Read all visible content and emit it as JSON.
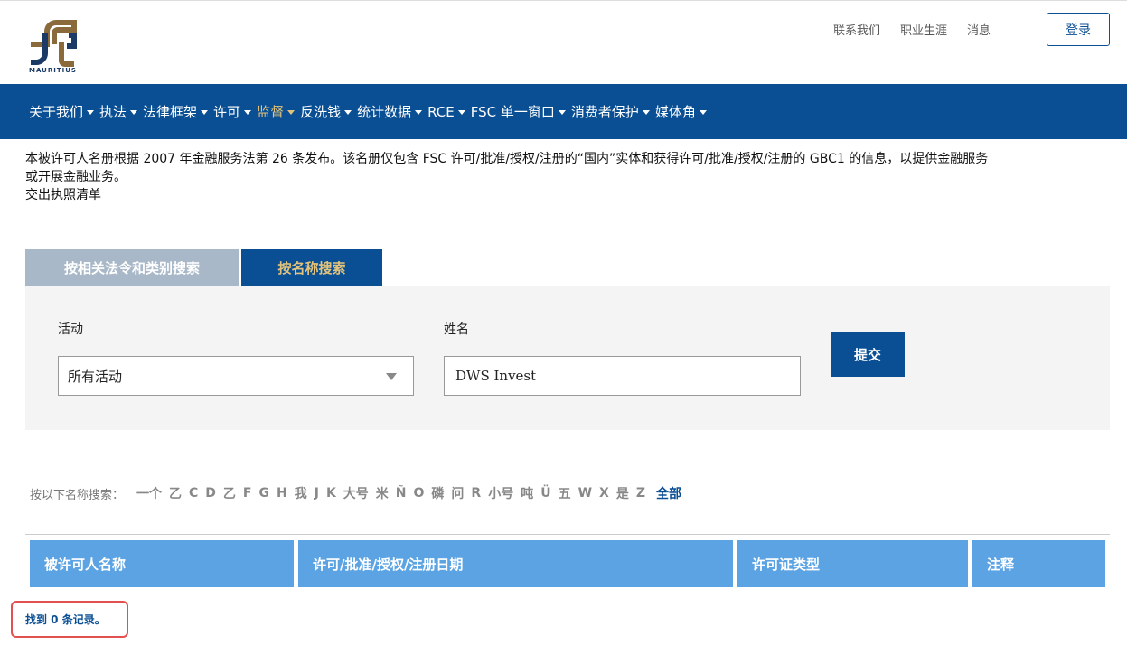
{
  "header": {
    "logo_alt": "MAURITIUS",
    "links": [
      "联系我们",
      "职业生涯",
      "消息"
    ],
    "login_label": "登录"
  },
  "nav": {
    "items": [
      {
        "label": "关于我们",
        "active": false
      },
      {
        "label": "执法",
        "active": false
      },
      {
        "label": "法律框架",
        "active": false
      },
      {
        "label": "许可",
        "active": false
      },
      {
        "label": "监督",
        "active": true
      },
      {
        "label": "反洗钱",
        "active": false
      },
      {
        "label": "统计数据",
        "active": false
      },
      {
        "label": "RCE",
        "active": false
      },
      {
        "label": "FSC 单一窗口",
        "active": false
      },
      {
        "label": "消费者保护",
        "active": false
      },
      {
        "label": "媒体角",
        "active": false
      }
    ]
  },
  "intro": {
    "line1": "本被许可人名册根据 2007 年金融服务法第 26 条发布。该名册仅包含 FSC 许可/批准/授权/注册的“国内”实体和获得许可/批准/授权/注册的 GBC1 的信息，以提供金融服务",
    "line2": "或开展金融业务。",
    "line3": "交出执照清单"
  },
  "tabs": {
    "category_label": "按相关法令和类别搜索",
    "name_label": "按名称搜索"
  },
  "search": {
    "activity_label": "活动",
    "activity_value": "所有活动",
    "name_label": "姓名",
    "name_value": "DWS Invest",
    "submit_label": "提交"
  },
  "alphabet": {
    "label": "按以下名称搜索：",
    "letters": [
      "一个",
      "乙",
      "C",
      "D",
      "乙",
      "F",
      "G",
      "H",
      "我",
      "J",
      "K",
      "大号",
      "米",
      "Ñ",
      "O",
      "磷",
      "问",
      "R",
      "小号",
      "吨",
      "Ü",
      "五",
      "W",
      "X",
      "是",
      "Z"
    ],
    "all_label": "全部"
  },
  "table": {
    "headers": [
      "被许可人名称",
      "许可/批准/授权/注册日期",
      "许可证类型",
      "注释"
    ]
  },
  "result": {
    "text": "找到 0 条记录。"
  },
  "colors": {
    "nav_bg": "#0a4f93",
    "active_gold": "#e3c37b",
    "table_header": "#5ba3e3",
    "highlight": "#e2504f"
  }
}
